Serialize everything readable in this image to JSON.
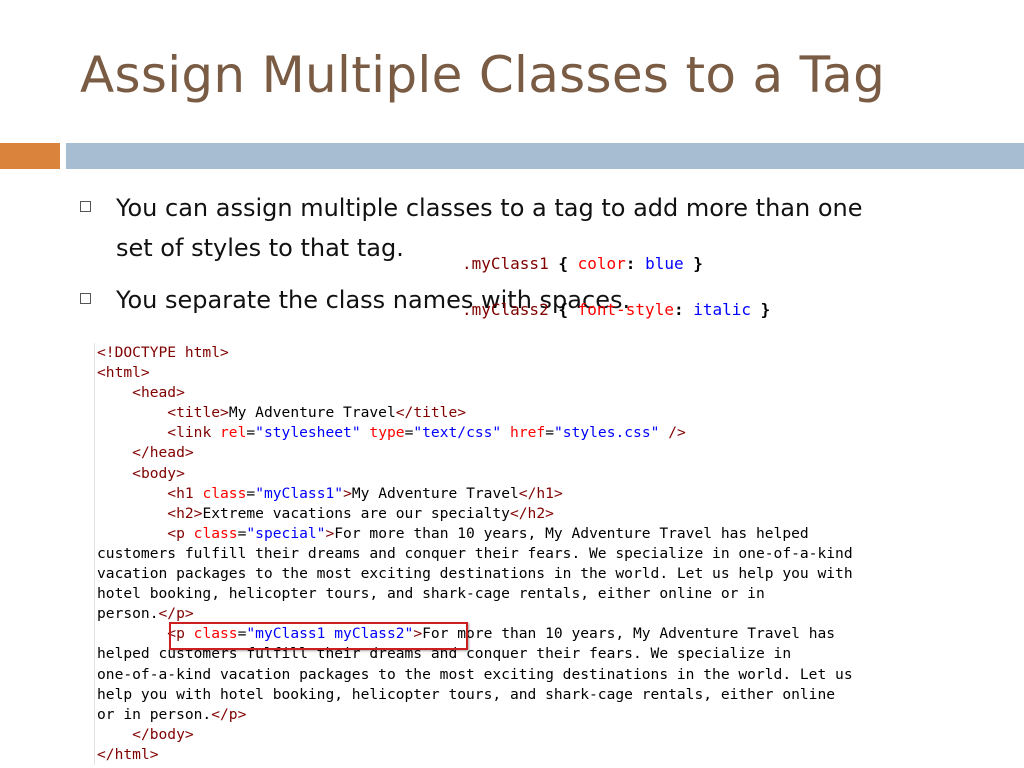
{
  "title": "Assign Multiple Classes to a Tag",
  "bullets": [
    {
      "line1": "You can assign multiple classes to a tag to add more than one",
      "line2": "set of styles to that tag."
    },
    {
      "line1": "You separate the class names with spaces."
    }
  ],
  "css_snippet": [
    {
      "selector": ".myClass1",
      "open": "{",
      "property": "color",
      "colon": ":",
      "value": "blue",
      "close": "}"
    },
    {
      "selector": ".myClass2",
      "open": "{",
      "property": "font-style",
      "colon": ":",
      "value": "italic",
      "close": "}"
    }
  ],
  "code_lines": [
    [
      [
        "tg",
        "<!DOCTYPE html>"
      ]
    ],
    [
      [
        "tg",
        "<html>"
      ]
    ],
    [
      [
        "tx",
        "    "
      ],
      [
        "tg",
        "<head>"
      ]
    ],
    [
      [
        "tx",
        "        "
      ],
      [
        "tg",
        "<title>"
      ],
      [
        "tx",
        "My Adventure Travel"
      ],
      [
        "tg",
        "</title>"
      ]
    ],
    [
      [
        "tx",
        "        "
      ],
      [
        "tg",
        "<link "
      ],
      [
        "an",
        "rel"
      ],
      [
        "tx",
        "="
      ],
      [
        "av",
        "\"stylesheet\""
      ],
      [
        "tx",
        " "
      ],
      [
        "an",
        "type"
      ],
      [
        "tx",
        "="
      ],
      [
        "av",
        "\"text/css\""
      ],
      [
        "tx",
        " "
      ],
      [
        "an",
        "href"
      ],
      [
        "tx",
        "="
      ],
      [
        "av",
        "\"styles.css\""
      ],
      [
        "tx",
        " "
      ],
      [
        "tg",
        "/>"
      ]
    ],
    [
      [
        "tx",
        "    "
      ],
      [
        "tg",
        "</head>"
      ]
    ],
    [
      [
        "tx",
        "    "
      ],
      [
        "tg",
        "<body>"
      ]
    ],
    [
      [
        "tx",
        "        "
      ],
      [
        "tg",
        "<h1 "
      ],
      [
        "an",
        "class"
      ],
      [
        "tx",
        "="
      ],
      [
        "av",
        "\"myClass1\""
      ],
      [
        "tg",
        ">"
      ],
      [
        "tx",
        "My Adventure Travel"
      ],
      [
        "tg",
        "</h1>"
      ]
    ],
    [
      [
        "tx",
        "        "
      ],
      [
        "tg",
        "<h2>"
      ],
      [
        "tx",
        "Extreme vacations are our specialty"
      ],
      [
        "tg",
        "</h2>"
      ]
    ],
    [
      [
        "tx",
        "        "
      ],
      [
        "tg",
        "<p "
      ],
      [
        "an",
        "class"
      ],
      [
        "tx",
        "="
      ],
      [
        "av",
        "\"special\""
      ],
      [
        "tg",
        ">"
      ],
      [
        "tx",
        "For more than 10 years, My Adventure Travel has helped"
      ]
    ],
    [
      [
        "tx",
        "customers fulfill their dreams and conquer their fears. We specialize in one-of-a-kind"
      ]
    ],
    [
      [
        "tx",
        "vacation packages to the most exciting destinations in the world. Let us help you with"
      ]
    ],
    [
      [
        "tx",
        "hotel booking, helicopter tours, and shark-cage rentals, either online or in"
      ]
    ],
    [
      [
        "tx",
        "person."
      ],
      [
        "tg",
        "</p>"
      ]
    ],
    [
      [
        "tx",
        "        "
      ],
      [
        "tg",
        "<p "
      ],
      [
        "an",
        "class"
      ],
      [
        "tx",
        "="
      ],
      [
        "av",
        "\"myClass1 myClass2\""
      ],
      [
        "tg",
        ">"
      ],
      [
        "tx",
        "For more than 10 years, My Adventure Travel has"
      ]
    ],
    [
      [
        "tx",
        "helped customers fulfill their dreams and conquer their fears. We specialize in"
      ]
    ],
    [
      [
        "tx",
        "one-of-a-kind vacation packages to the most exciting destinations in the world. Let us"
      ]
    ],
    [
      [
        "tx",
        "help you with hotel booking, helicopter tours, and shark-cage rentals, either online"
      ]
    ],
    [
      [
        "tx",
        "or in person."
      ],
      [
        "tg",
        "</p>"
      ]
    ],
    [
      [
        "tx",
        "    "
      ],
      [
        "tg",
        "</body>"
      ]
    ],
    [
      [
        "tg",
        "</html>"
      ]
    ]
  ]
}
